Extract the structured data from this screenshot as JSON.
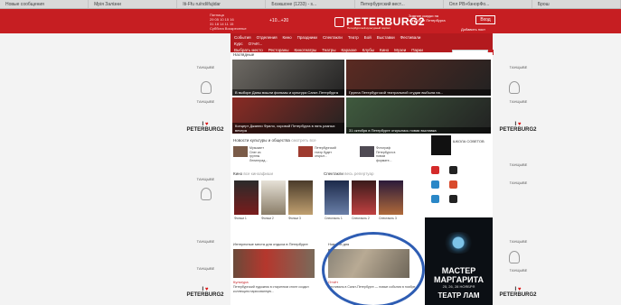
{
  "browser_tabs": [
    "Новые сообщения",
    "Мрія Залізни",
    "Iti-Ffu ru/nd/ifujidar",
    "Бозкшоне (1233) - s...",
    "Петербургский вест...",
    "Олл РВ»бзнорФо...",
    "Брош"
  ],
  "header": {
    "date_lines": [
      "Пятница",
      "29 05 10 15 16",
      "31 18 14 11 15",
      "Суббота Воскресенье"
    ],
    "weather": "+10...+20",
    "logo_text": "PETERBURG2",
    "logo_sub": "Петербургский культурный портал",
    "promo_text": "Зимние скидки на экскурсии Петербурга",
    "login_label": "Вход",
    "add_label": "Добавить пост"
  },
  "nav": {
    "row1": [
      "События",
      "Отделения",
      "Кино",
      "Праздники",
      "Спектакли",
      "Театр",
      "Бой",
      "Выставки",
      "Фестивали"
    ],
    "row2": [
      "Курс",
      "Отчёт..."
    ],
    "row3": [
      "Выбрать место",
      "Рестораны",
      "Кинотеатры",
      "Театры",
      "Караоке",
      "Клубы",
      "Кино",
      "Музеи",
      "Парки"
    ],
    "breadcrumb": "Наглядные"
  },
  "side": {
    "word": "ТАНЦЫВЕ",
    "heart_top": "I",
    "heart_bottom": "PETERBURG2"
  },
  "tiles": [
    {
      "caption": "В выборе Даны вошли фильмы и культура Санкт-Петербурга",
      "color": "#6e6a64"
    },
    {
      "caption": "Группа Петербургской театральной студии выбыла на...",
      "color": "#5b2a22"
    },
    {
      "caption": "Концерт Джанни Фрило, хоровой Петербурга в пять разных вечера",
      "color": "#8a2b24"
    },
    {
      "caption": "31 октября в Петербурге открылась новая выставка",
      "color": "#3f5a3e"
    }
  ],
  "culture": {
    "title": "Новости культуры и общества",
    "more": "смотреть все",
    "items": [
      "Музыкант Олег из группы Ленинград...",
      "Петербургский театр будет открыт...",
      "Фотограф Петербурга в новом формате..."
    ]
  },
  "cinema": {
    "title": "Кино",
    "more": "все киноафиши",
    "posters": [
      "Фильм 1",
      "Фильм 2",
      "Фильм 3"
    ]
  },
  "theatre": {
    "title": "Спектакли",
    "more": "весь репертуар",
    "posters": [
      "Спектакль 1",
      "Спектакль 2",
      "Спектакль 3"
    ]
  },
  "catalog": {
    "banner_text": "ШКОЛА СОВЕТОВ",
    "icons": [
      "people-icon",
      "bag-icon",
      "camera-icon",
      "grid-icon",
      "wifi-icon",
      "cup-icon"
    ]
  },
  "ad": {
    "line1": "МАСТЕР",
    "line2": "МАРГАРИТА",
    "dates": "25, 26, 28 НОЯБРЯ",
    "theatre": "ТЕАТР ЛАМ"
  },
  "bottom": {
    "left_title": "Интересные места для отдыха в Петербурге",
    "left_text": "Петербургский художник в старинном стиле создал коллекцию нарисованную...",
    "left_tag": "Культура",
    "right_title": "Новости дня",
    "right_text": "Фестиваль в Санкт-Петербурге — новые события в ноябре...",
    "right_tag": "Отчёт"
  }
}
